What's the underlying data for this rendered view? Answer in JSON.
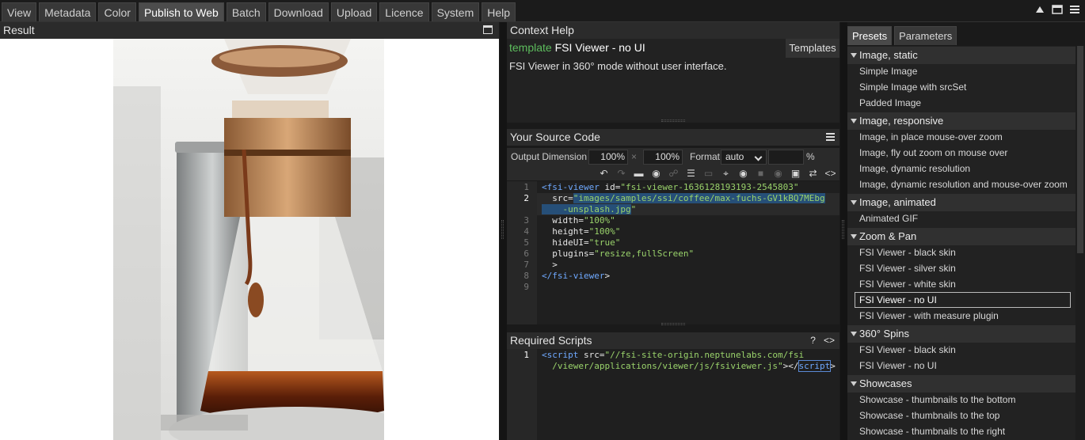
{
  "tabs": [
    "View",
    "Metadata",
    "Color",
    "Publish to Web",
    "Batch",
    "Download",
    "Upload",
    "Licence",
    "System",
    "Help"
  ],
  "active_tab": "Publish to Web",
  "window_icons": [
    "minimize-triangle-icon",
    "window-icon",
    "menu-icon"
  ],
  "result": {
    "title": "Result",
    "image_alt": "Chemex coffee maker with coffee"
  },
  "context_help": {
    "title": "Context Help",
    "template_keyword": "template",
    "template_name": "FSI Viewer - no UI",
    "templates_button": "Templates",
    "description": "FSI Viewer in 360° mode without user interface."
  },
  "source_code": {
    "title": "Your Source Code",
    "output_dimension_label": "Output Dimension",
    "width_value": "100%",
    "times_symbol": "×",
    "height_value": "100%",
    "format_label": "Format",
    "format_value": "auto",
    "quality_value": "",
    "percent_symbol": "%",
    "line_numbers": [
      "1",
      "2",
      "3",
      "4",
      "5",
      "6",
      "7",
      "8",
      "9"
    ],
    "lines": [
      {
        "tag_open": "<fsi-viewer",
        "attr": " id=",
        "val": "\"fsi-viewer-1636128193193-2545803\""
      },
      {
        "attr": "  src=",
        "val": "\"images/samples/ssi/coffee/max-fuchs-GV1kBQ7MEbg"
      },
      {
        "val": "    -unsplash.jpg",
        "rest": "\""
      },
      {
        "attr": "  width=",
        "val": "\"100%\""
      },
      {
        "attr": "  height=",
        "val": "\"100%\""
      },
      {
        "attr": "  hideUI=",
        "val": "\"true\""
      },
      {
        "attr": "  plugins=",
        "val": "\"resize,fullScreen\""
      },
      {
        "rest": "  >"
      },
      {
        "tag_open": "</fsi-viewer",
        "rest": ">"
      }
    ]
  },
  "required_scripts": {
    "title": "Required Scripts",
    "help": "?",
    "code_icon": "<>",
    "line_numbers": [
      "1"
    ],
    "line1_tag": "<script",
    "line1_attr": " src=",
    "line1_val": "\"//fsi-site-origin.neptunelabs.com/fsi",
    "line2_val": "  /viewer/applications/viewer/js/fsiviewer.js\"",
    "line2_close1": "></",
    "line2_close_tag": "script",
    "line2_close2": ">"
  },
  "right_tabs": [
    "Presets",
    "Parameters"
  ],
  "active_right_tab": "Presets",
  "presets": [
    {
      "section": "Image, static",
      "items": [
        "Simple Image",
        "Simple Image with srcSet",
        "Padded Image"
      ]
    },
    {
      "section": "Image, responsive",
      "items": [
        "Image, in place mouse-over zoom",
        "Image, fly out zoom on mouse over",
        "Image, dynamic resolution",
        "Image, dynamic resolution and mouse-over zoom"
      ]
    },
    {
      "section": "Image, animated",
      "items": [
        "Animated GIF"
      ]
    },
    {
      "section": "Zoom & Pan",
      "items": [
        "FSI Viewer - black skin",
        "FSI Viewer - silver skin",
        "FSI Viewer - white skin",
        "FSI Viewer - no UI",
        "FSI Viewer - with measure plugin"
      ]
    },
    {
      "section": "360° Spins",
      "items": [
        "FSI Viewer - black skin",
        "FSI Viewer - no UI"
      ]
    },
    {
      "section": "Showcases",
      "items": [
        "Showcase - thumbnails to the bottom",
        "Showcase - thumbnails to the top",
        "Showcase - thumbnails to the right"
      ]
    }
  ],
  "selected_preset": "FSI Viewer - no UI"
}
